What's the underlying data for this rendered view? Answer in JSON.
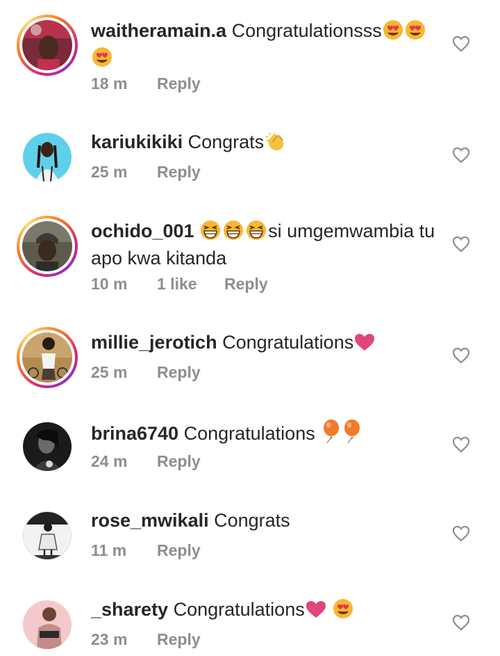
{
  "comments": [
    {
      "username": "waitheramain.a",
      "text": "Congratulationsss",
      "emojis": [
        "heart-eyes",
        "heart-eyes",
        "heart-eyes"
      ],
      "time": "18 m",
      "likes": "",
      "reply": "Reply",
      "story_ring": true
    },
    {
      "username": "kariukikiki",
      "text": "Congrats",
      "emojis": [
        "clapping-hands"
      ],
      "time": "25 m",
      "likes": "",
      "reply": "Reply",
      "story_ring": false
    },
    {
      "username": "ochido_001",
      "text": "si umgemwambia tu apo kwa kitanda",
      "emojis": [
        "grinning-squint",
        "grinning-squint",
        "grinning-squint"
      ],
      "time": "10 m",
      "likes": "1 like",
      "reply": "Reply",
      "story_ring": true
    },
    {
      "username": "millie_jerotich",
      "text": "Congratulations",
      "emojis": [
        "pink-heart"
      ],
      "time": "25 m",
      "likes": "",
      "reply": "Reply",
      "story_ring": true
    },
    {
      "username": "brina6740",
      "text": "Congratulations",
      "emojis": [
        "balloon",
        "balloon"
      ],
      "time": "24 m",
      "likes": "",
      "reply": "Reply",
      "story_ring": false
    },
    {
      "username": "rose_mwikali",
      "text": "Congrats",
      "emojis": [],
      "time": "11 m",
      "likes": "",
      "reply": "Reply",
      "story_ring": false
    },
    {
      "username": "_sharety",
      "text": "Congratulations",
      "emojis": [
        "pink-heart",
        "heart-eyes"
      ],
      "time": "23 m",
      "likes": "",
      "reply": "Reply",
      "story_ring": false
    }
  ],
  "icons": {
    "like": "heart-outline-icon"
  },
  "colors": {
    "text": "#262626",
    "meta": "#8e8e8e",
    "heart_outline": "#8e8e8e",
    "story_ring_start": "#d62976",
    "story_ring_end": "#fa7e1e"
  }
}
